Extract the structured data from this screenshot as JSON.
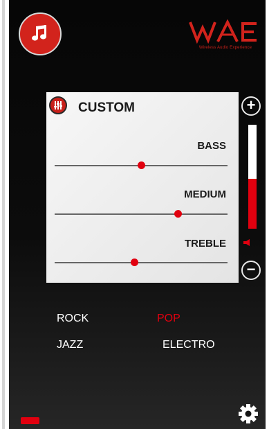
{
  "logo": {
    "text": "Wireless Audio Experience"
  },
  "equalizer": {
    "title": "CUSTOM",
    "bands": [
      {
        "label": "BASS",
        "value": 0.5
      },
      {
        "label": "MEDIUM",
        "value": 0.71
      },
      {
        "label": "TREBLE",
        "value": 0.46
      }
    ]
  },
  "volume": {
    "level": 0.48,
    "plus_label": "+",
    "minus_label": "−"
  },
  "presets": [
    {
      "label": "ROCK",
      "selected": false
    },
    {
      "label": "POP",
      "selected": true
    },
    {
      "label": "JAZZ",
      "selected": false
    },
    {
      "label": "ELECTRO",
      "selected": false
    }
  ],
  "battery": {
    "level": 1.0
  },
  "colors": {
    "accent": "#e1000f",
    "background": "#0a0a0a",
    "panel": "#eeeeee",
    "preset_text": "#ffffff"
  },
  "icons": [
    "music-note-icon",
    "equalizer-icon",
    "speaker-icon",
    "battery-icon",
    "gear-icon"
  ]
}
